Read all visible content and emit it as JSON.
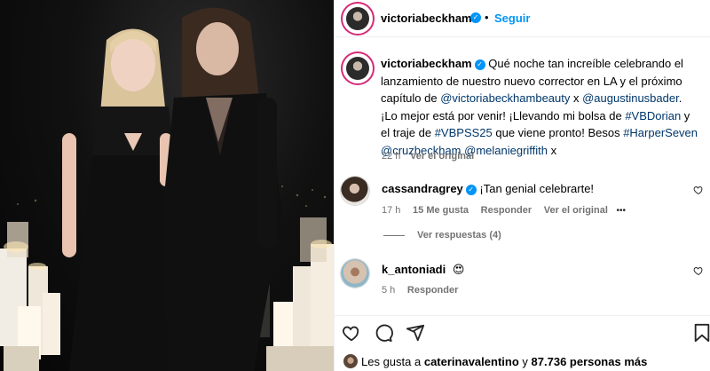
{
  "post": {
    "author": "victoriabeckham",
    "follow_label": "Seguir",
    "dot": "•",
    "caption": {
      "t1": "Qué noche tan increíble celebrando el lanzamiento de nuestro nuevo corrector en LA y el próximo capítulo de ",
      "m1": "@victoriabeckhambeauty",
      "t2": " x ",
      "m2": "@augustinusbader",
      "t3": ". ¡Lo mejor está por venir! ¡Llevando mi bolsa de ",
      "h1": "#VBDorian",
      "t4": " y el traje de ",
      "h2": "#VBPSS25",
      "t5": " que viene pronto! Besos ",
      "h3": "#HarperSeven",
      "m3": "@cruzbeckham",
      "m4": "@melaniegriffith",
      "t6": " x"
    },
    "caption_time": "22 h",
    "see_translation": "Ver el original"
  },
  "comments": [
    {
      "username": "cassandragrey",
      "text": "¡Tan genial celebrarte!",
      "time": "17 h",
      "likes": "15 Me gusta",
      "reply": "Responder",
      "see_original": "Ver el original",
      "more": "•••",
      "view_replies": "Ver respuestas (4)"
    },
    {
      "username": "k_antoniadi",
      "emoji": "😍",
      "time": "5 h",
      "reply": "Responder"
    }
  ],
  "likes": {
    "prefix": "Les gusta a",
    "user": "caterinavalentino",
    "middle": "y",
    "count": "87.736 personas más"
  },
  "icons": [
    "heart-icon",
    "comment-icon",
    "share-icon",
    "bookmark-icon",
    "verified-badge-icon",
    "more-options-icon"
  ],
  "colors": {
    "accent": "#0095f6",
    "link": "#00376b",
    "muted": "#737373",
    "like_red": "#ff3040"
  }
}
